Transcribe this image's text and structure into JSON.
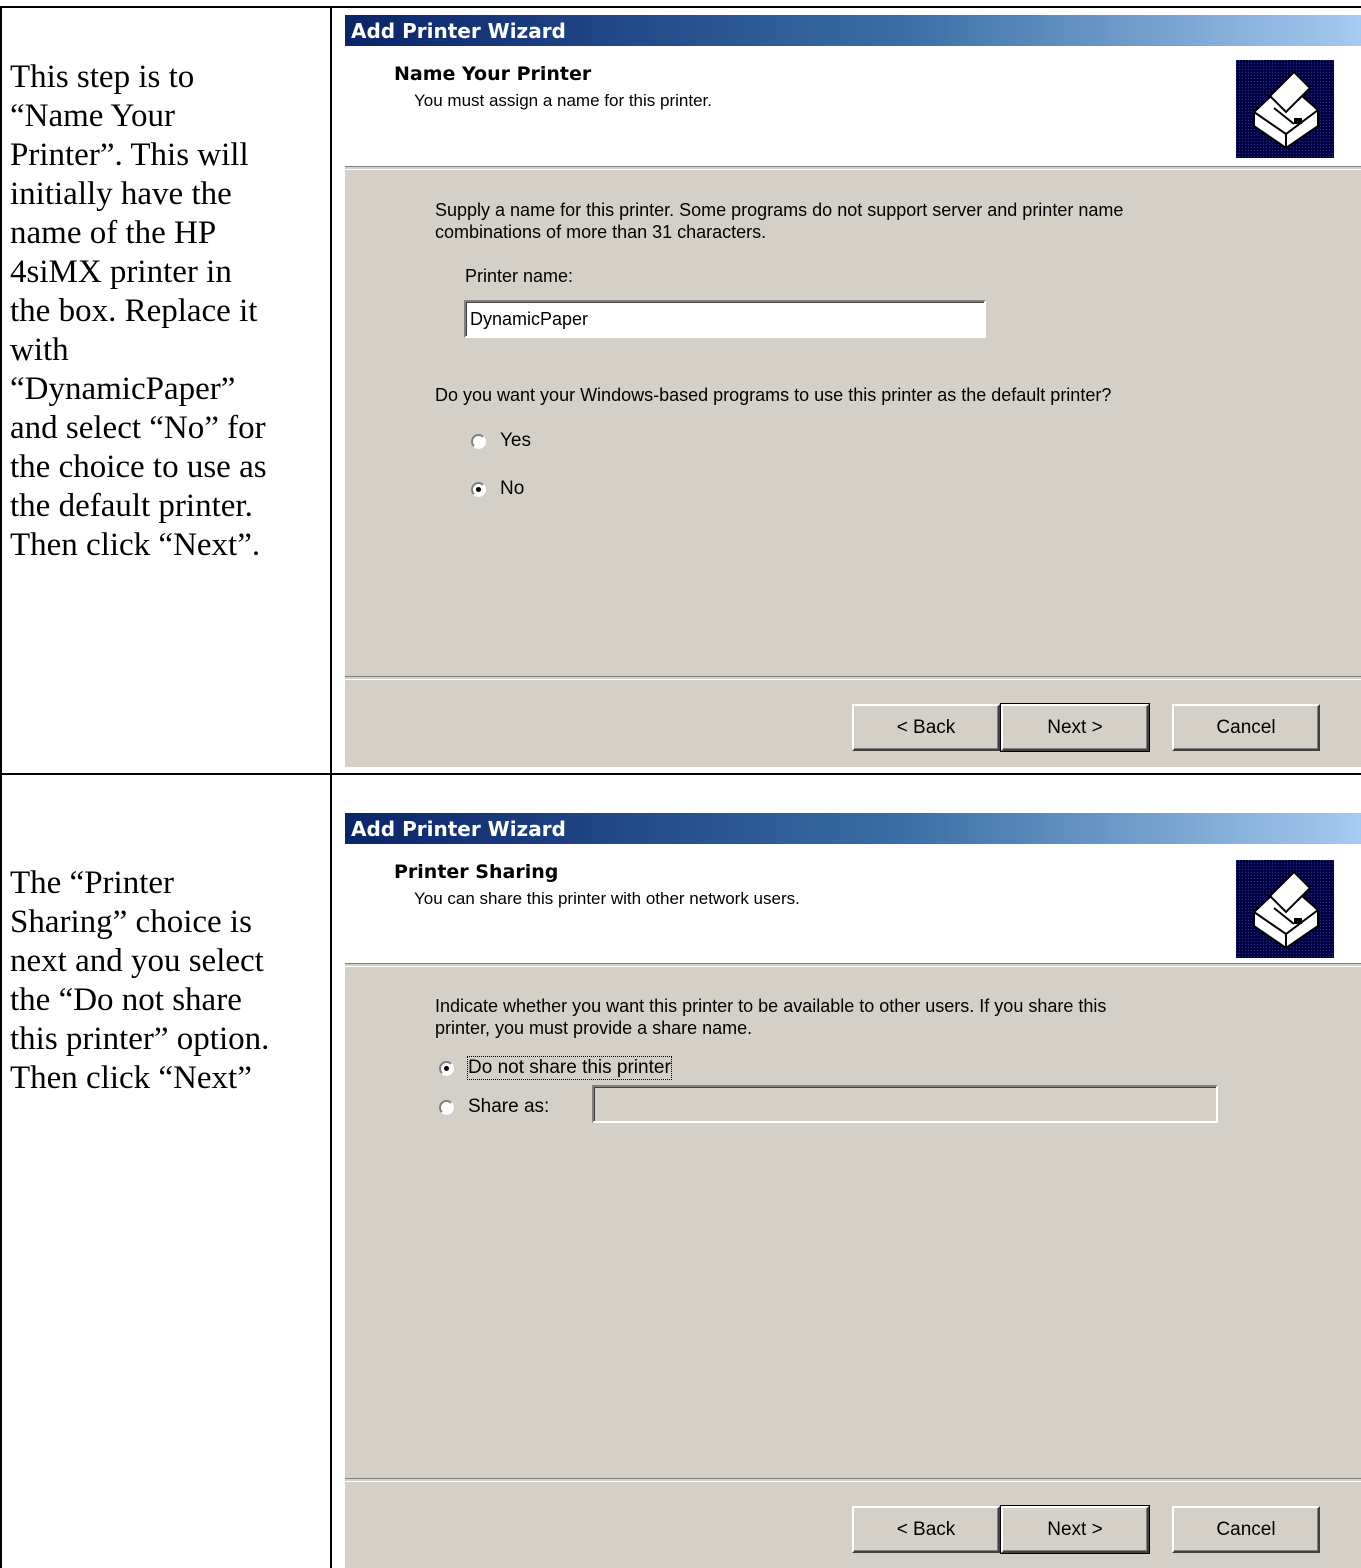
{
  "rows": [
    {
      "instruction_lines": [
        "This step is to",
        "“Name Your",
        "Printer”.  This will",
        "initially have the",
        "name of the HP",
        "4siMX printer in",
        "the box.  Replace it",
        "with",
        "“DynamicPaper”",
        "and select “No” for",
        "the choice to use as",
        "the default printer.",
        "Then click “Next”."
      ],
      "wizard": {
        "window_title": "Add Printer Wizard",
        "header_title": "Name Your Printer",
        "header_subtitle": "You must assign a name for this printer.",
        "icon": "printer-icon",
        "description_lines": [
          "Supply a name for this printer. Some programs do not support server and printer name",
          "combinations of more than 31 characters."
        ],
        "printer_name_label": "Printer name:",
        "printer_name_value": "DynamicPaper",
        "default_question": "Do you want your Windows-based programs to use this printer as the default printer?",
        "radio_yes": "Yes",
        "radio_no": "No",
        "selected": "No",
        "buttons": {
          "back": "< Back",
          "next": "Next >",
          "cancel": "Cancel"
        }
      }
    },
    {
      "instruction_lines": [
        "The “Printer",
        "Sharing” choice is",
        "next and you select",
        "the “Do not share",
        "this printer” option.",
        "Then click “Next”"
      ],
      "wizard": {
        "window_title": "Add Printer Wizard",
        "header_title": "Printer Sharing",
        "header_subtitle": "You can share this printer with other network users.",
        "icon": "printer-icon",
        "description_lines": [
          "Indicate whether you want this printer to be available to other users. If you share this",
          "printer, you must provide a share name."
        ],
        "radio_do_not_share": "Do not share this printer",
        "radio_share_as": "Share as:",
        "share_name_value": "",
        "selected": "Do not share this printer",
        "buttons": {
          "back": "< Back",
          "next": "Next >",
          "cancel": "Cancel"
        }
      }
    }
  ]
}
